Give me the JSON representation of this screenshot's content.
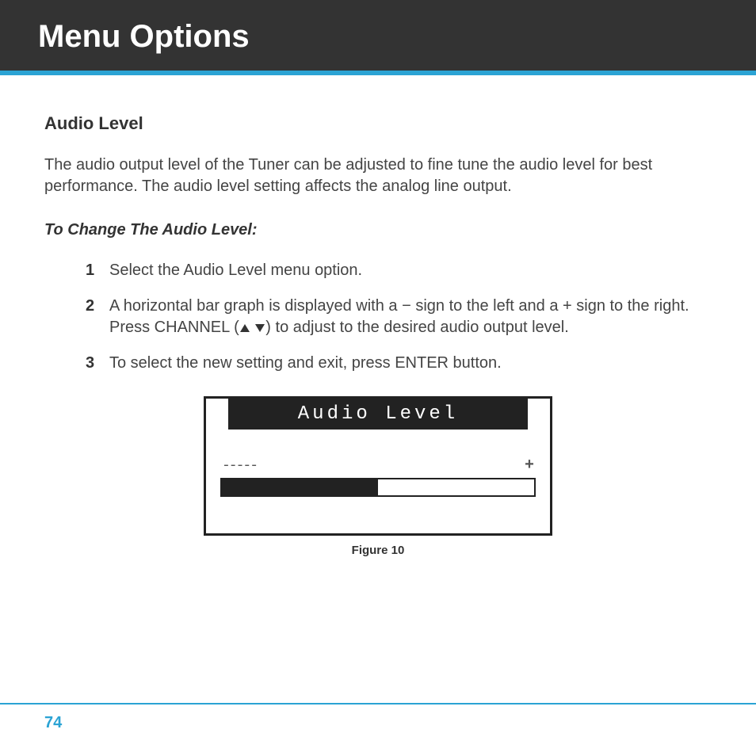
{
  "header": {
    "title": "Menu Options"
  },
  "section": {
    "heading": "Audio Level",
    "intro": "The audio output level of the Tuner can be adjusted to fine tune the audio level for best performance. The audio level setting affects the analog line output.",
    "subheading": "To Change The Audio Level:"
  },
  "steps": [
    {
      "num": "1",
      "text": "Select the Audio Level menu option."
    },
    {
      "num": "2",
      "text_before": "A horizontal bar graph is displayed with a − sign to the left and a + sign to the right. Press CHANNEL (",
      "text_after": ") to adjust to the desired audio output level."
    },
    {
      "num": "3",
      "text": "To select the new setting and exit, press ENTER button."
    }
  ],
  "figure": {
    "lcd_title": "Audio Level",
    "minus": "-----",
    "plus": "+",
    "caption": "Figure 10"
  },
  "chart_data": {
    "type": "bar",
    "title": "Audio Level",
    "xlabel": "",
    "ylabel": "",
    "categories": [
      "level"
    ],
    "values": [
      50
    ],
    "ylim": [
      0,
      100
    ],
    "notes": "Horizontal progress bar showing approximately 50% fill between minus and plus endpoints"
  },
  "footer": {
    "page_number": "74"
  }
}
